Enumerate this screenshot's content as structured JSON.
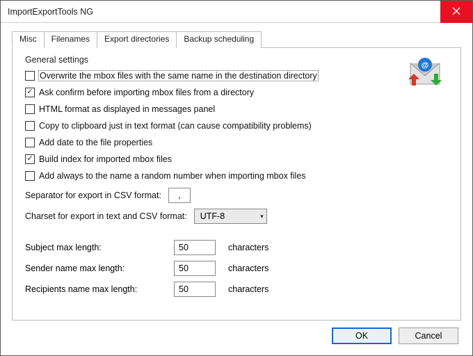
{
  "window": {
    "title": "ImportExportTools NG"
  },
  "tabs": [
    {
      "label": "Misc",
      "active": true
    },
    {
      "label": "Filenames",
      "active": false
    },
    {
      "label": "Export directories",
      "active": false
    },
    {
      "label": "Backup scheduling",
      "active": false
    }
  ],
  "group": {
    "title": "General settings"
  },
  "checks": [
    {
      "label": "Overwrite the mbox files with the same name in the destination directory",
      "checked": false,
      "focused": true
    },
    {
      "label": "Ask confirm before importing mbox files from a directory",
      "checked": true,
      "focused": false
    },
    {
      "label": "HTML format as displayed in messages panel",
      "checked": false,
      "focused": false
    },
    {
      "label": "Copy to clipboard just in text format (can cause compatibility problems)",
      "checked": false,
      "focused": false
    },
    {
      "label": "Add date to the file properties",
      "checked": false,
      "focused": false
    },
    {
      "label": "Build index for imported mbox files",
      "checked": true,
      "focused": false
    },
    {
      "label": "Add always to the name a random number when importing mbox files",
      "checked": false,
      "focused": false
    }
  ],
  "separator": {
    "label": "Separator for export in CSV format:",
    "value": ","
  },
  "charset": {
    "label": "Charset for export in text and CSV format:",
    "value": "UTF-8"
  },
  "lengths": {
    "subject": {
      "label": "Subject max length:",
      "value": "50",
      "suffix": "characters"
    },
    "sender": {
      "label": "Sender name max length:",
      "value": "50",
      "suffix": "characters"
    },
    "recipients": {
      "label": "Recipients name max length:",
      "value": "50",
      "suffix": "characters"
    }
  },
  "buttons": {
    "ok": "OK",
    "cancel": "Cancel"
  }
}
